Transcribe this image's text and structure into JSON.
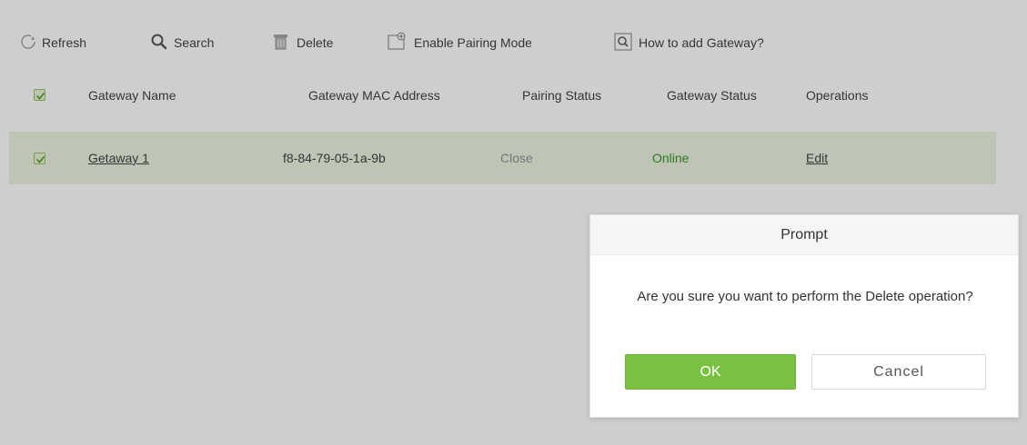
{
  "toolbar": {
    "refresh_label": "Refresh",
    "search_label": "Search",
    "delete_label": "Delete",
    "pairing_label": "Enable Pairing Mode",
    "howto_label": "How to add Gateway?"
  },
  "table": {
    "columns": [
      "Gateway Name",
      "Gateway MAC Address",
      "Pairing Status",
      "Gateway Status",
      "Operations"
    ],
    "rows": [
      {
        "name": "Getaway 1",
        "mac": "f8-84-79-05-1a-9b",
        "pairing": "Close",
        "status": "Online",
        "operation": "Edit"
      }
    ]
  },
  "dialog": {
    "title": "Prompt",
    "message": "Are you sure you want to perform the Delete operation?",
    "ok_label": "OK",
    "cancel_label": "Cancel"
  },
  "colors": {
    "online": "#2e8b1f",
    "pairing_close": "#8a8a8a",
    "row_selected": "#eaf3de",
    "ok_button": "#7ac143"
  },
  "icons": {
    "refresh": "refresh-icon",
    "search": "search-icon",
    "delete": "trash-icon",
    "pairing": "pairing-mode-icon",
    "howto": "help-search-icon"
  }
}
